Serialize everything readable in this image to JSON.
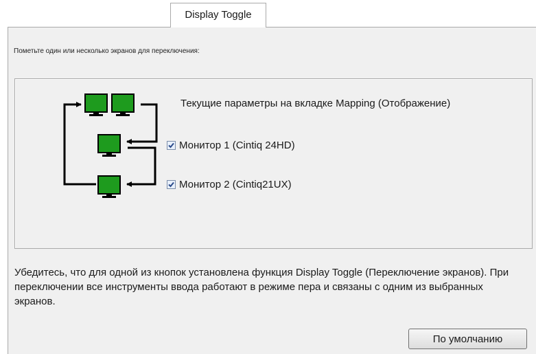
{
  "tab": {
    "label": "Display Toggle"
  },
  "instruction": "Пометьте один или несколько экранов для переключения:",
  "mapping_text": "Текущие параметры на вкладке Mapping (Отображение)",
  "monitors": [
    {
      "label": "Монитор 1 (Cintiq 24HD)",
      "checked": true
    },
    {
      "label": "Монитор 2 (Cintiq21UX)",
      "checked": true
    }
  ],
  "note": "Убедитесь, что для одной из кнопок установлена функция Display Toggle (Переключение экранов). При переключении все инструменты ввода работают в режиме пера и связаны с одним из выбранных экранов.",
  "default_button": "По умолчанию",
  "colors": {
    "monitor": "#1e9b1e",
    "panel": "#f0f0f0",
    "border": "#a9a9a9"
  },
  "icons": [
    "monitor-icon",
    "arrow-icon",
    "checkmark-icon"
  ]
}
